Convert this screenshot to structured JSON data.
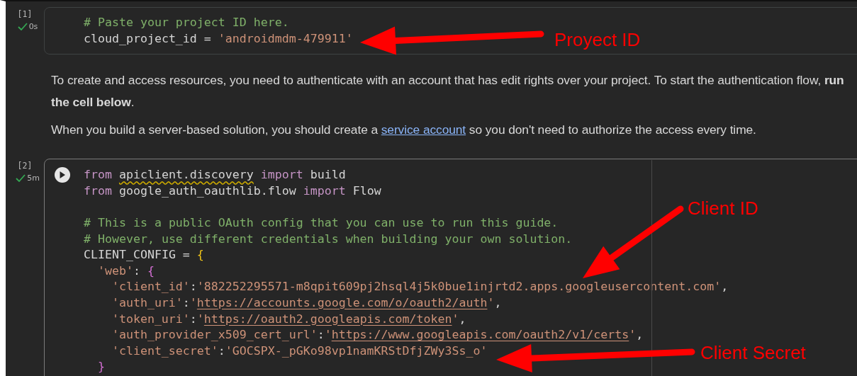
{
  "cells": [
    {
      "kind": "code",
      "execution_count": "[1]",
      "status": "0s",
      "done": true,
      "run_button": false,
      "focused": false,
      "lines": [
        {
          "kind": "code",
          "tokens": [
            {
              "kind": "comment",
              "text": "# Paste your project ID here."
            }
          ]
        },
        {
          "kind": "code",
          "tokens": [
            {
              "kind": "plain",
              "text": "cloud_project_id = "
            },
            {
              "kind": "string",
              "text": "'androidmdm-479911'"
            }
          ]
        }
      ]
    },
    {
      "kind": "text",
      "paragraphs": [
        [
          {
            "kind": "text",
            "text": "To create and access resources, you need to authenticate with an account that has edit rights over your project. To start the authentication flow, **run the cell below**."
          }
        ],
        [
          {
            "kind": "text",
            "text": "When you build a server-based solution, you should create a "
          },
          {
            "kind": "link",
            "text": "service account"
          },
          {
            "kind": "text",
            "text": " so you don't need to authorize the access every time."
          }
        ]
      ]
    },
    {
      "kind": "code",
      "execution_count": "[2]",
      "status": "5m",
      "done": true,
      "run_button": true,
      "focused": true,
      "lines": [
        {
          "kind": "code",
          "tokens": [
            {
              "kind": "keyword",
              "text": "from "
            },
            {
              "kind": "warning",
              "text": "apiclient.discovery"
            },
            {
              "kind": "keyword",
              "text": " import"
            },
            {
              "kind": "plain",
              "text": " build"
            }
          ]
        },
        {
          "kind": "code",
          "tokens": [
            {
              "kind": "keyword",
              "text": "from"
            },
            {
              "kind": "plain",
              "text": " google_auth_oauthlib.flow "
            },
            {
              "kind": "keyword",
              "text": "import"
            },
            {
              "kind": "plain",
              "text": " Flow"
            }
          ]
        },
        {
          "kind": "blank"
        },
        {
          "kind": "code",
          "tokens": [
            {
              "kind": "comment",
              "text": "# This is a public OAuth config that you can use to run this guide."
            }
          ]
        },
        {
          "kind": "code",
          "tokens": [
            {
              "kind": "comment",
              "text": "# However, use different credentials when building your own solution."
            }
          ]
        },
        {
          "kind": "code",
          "tokens": [
            {
              "kind": "plain",
              "text": "CLIENT_CONFIG = "
            },
            {
              "kind": "brace",
              "text": "{"
            }
          ],
          "children": [
            {
              "kind": "code",
              "tokens": [
                {
                  "kind": "string",
                  "text": "'web'"
                },
                {
                  "kind": "plain",
                  "text": ": "
                },
                {
                  "kind": "inner_brace",
                  "text": "{"
                }
              ],
              "children": [
                {
                  "kind": "code",
                  "tokens": [
                    {
                      "kind": "string",
                      "text": "'client_id'"
                    },
                    {
                      "kind": "plain",
                      "text": ":"
                    },
                    {
                      "kind": "string",
                      "text": "'882252295571-m8qpit609pj2hsql4j5k0bue1injrtd2.apps.googleusercontent.com'"
                    },
                    {
                      "kind": "plain",
                      "text": ","
                    }
                  ]
                },
                {
                  "kind": "code",
                  "tokens": [
                    {
                      "kind": "string",
                      "text": "'auth_uri'"
                    },
                    {
                      "kind": "plain",
                      "text": ":"
                    },
                    {
                      "kind": "string",
                      "text": "'"
                    },
                    {
                      "kind": "link",
                      "text": "https://accounts.google.com/o/oauth2/auth"
                    },
                    {
                      "kind": "string",
                      "text": "'"
                    },
                    {
                      "kind": "plain",
                      "text": ","
                    }
                  ]
                },
                {
                  "kind": "code",
                  "tokens": [
                    {
                      "kind": "string",
                      "text": "'token_uri'"
                    },
                    {
                      "kind": "plain",
                      "text": ":"
                    },
                    {
                      "kind": "string",
                      "text": "'"
                    },
                    {
                      "kind": "link",
                      "text": "https://oauth2.googleapis.com/token"
                    },
                    {
                      "kind": "string",
                      "text": "'"
                    },
                    {
                      "kind": "plain",
                      "text": ","
                    }
                  ]
                },
                {
                  "kind": "code",
                  "tokens": [
                    {
                      "kind": "string",
                      "text": "'auth_provider_x509_cert_url'"
                    },
                    {
                      "kind": "plain",
                      "text": ":"
                    },
                    {
                      "kind": "string",
                      "text": "'"
                    },
                    {
                      "kind": "link",
                      "text": "https://www.googleapis.com/oauth2/v1/certs"
                    },
                    {
                      "kind": "string",
                      "text": "'"
                    },
                    {
                      "kind": "plain",
                      "text": ","
                    }
                  ]
                },
                {
                  "kind": "code",
                  "tokens": [
                    {
                      "kind": "string",
                      "text": "'client_secret'"
                    },
                    {
                      "kind": "plain",
                      "text": ":"
                    },
                    {
                      "kind": "string",
                      "text": "'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'"
                    }
                  ]
                }
              ]
            },
            {
              "kind": "code",
              "tokens": [
                {
                  "kind": "inner_brace",
                  "text": "}"
                }
              ]
            }
          ]
        }
      ]
    }
  ],
  "annotations": [
    {
      "label": "Proyect ID"
    },
    {
      "label": "Client ID"
    },
    {
      "label": "Client Secret"
    }
  ]
}
